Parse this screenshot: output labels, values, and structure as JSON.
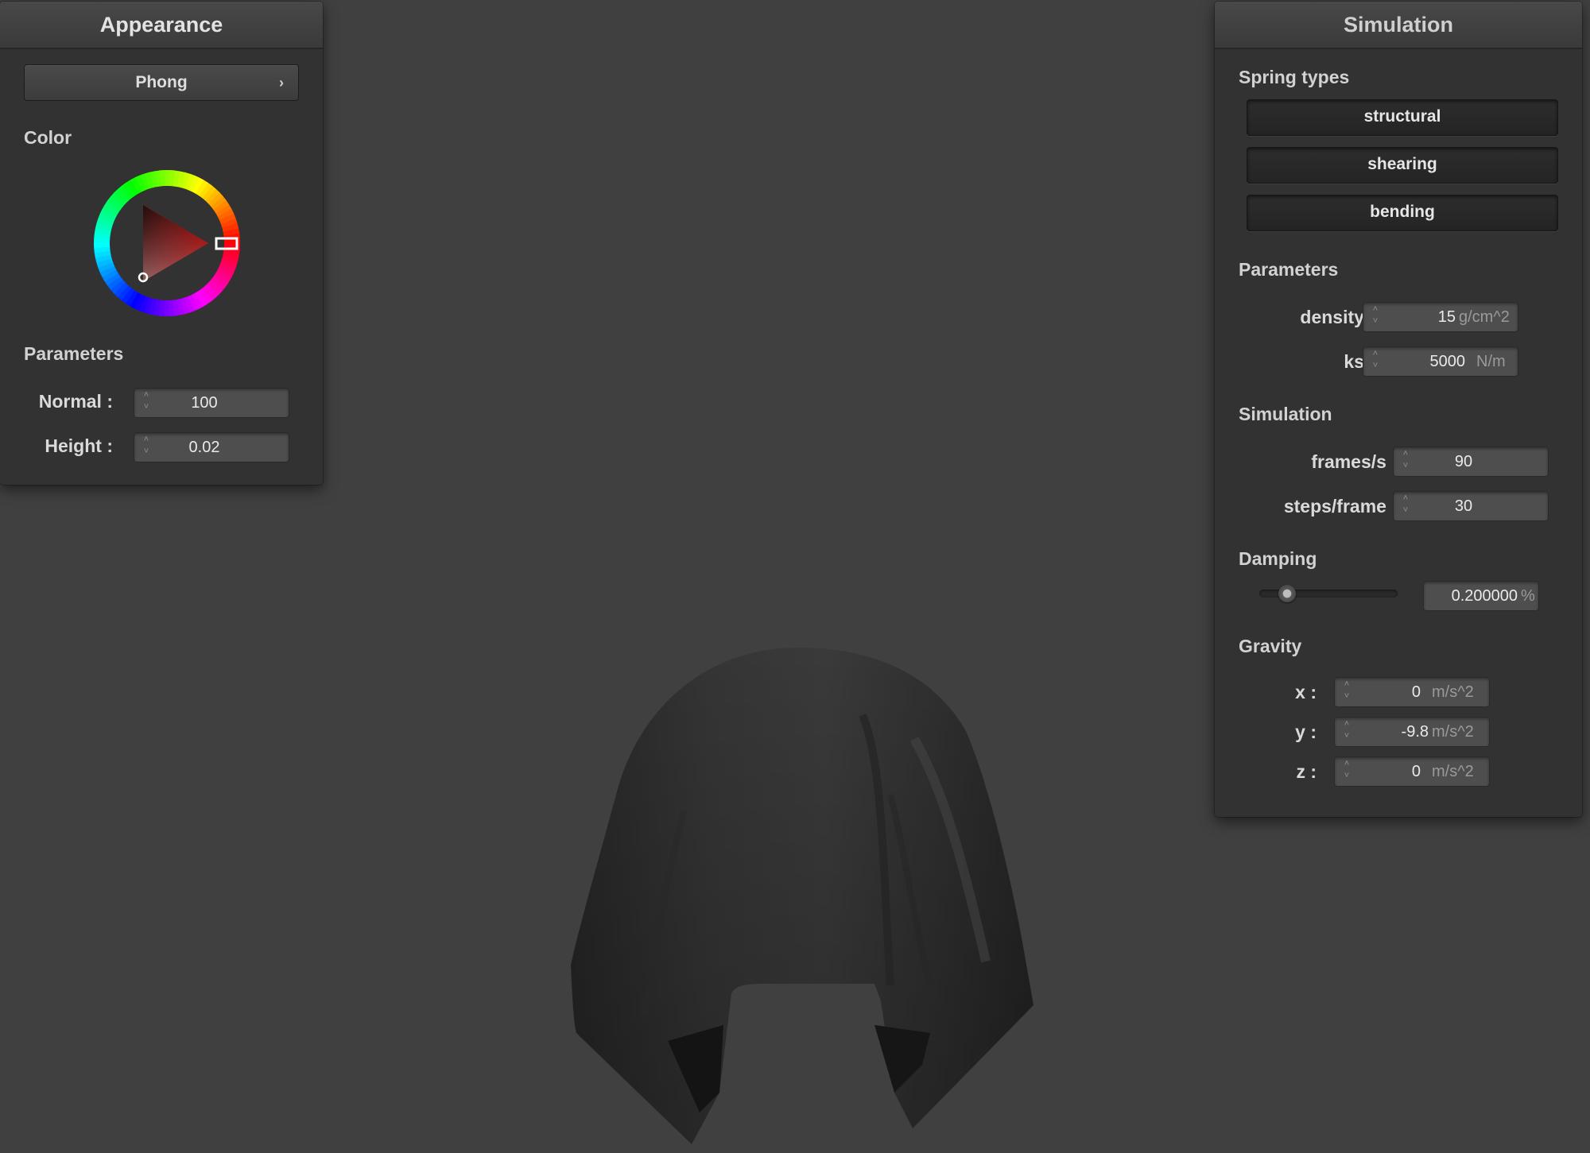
{
  "appearance": {
    "title": "Appearance",
    "shader": "Phong",
    "color_label": "Color",
    "selected_color": "#e01010",
    "parameters_label": "Parameters",
    "normal_label": "Normal :",
    "normal_value": "100",
    "height_label": "Height :",
    "height_value": "0.02"
  },
  "simulation": {
    "title": "Simulation",
    "spring_types_label": "Spring types",
    "springs": [
      "structural",
      "shearing",
      "bending"
    ],
    "parameters_label": "Parameters",
    "density_label": "density :",
    "density_value": "15",
    "density_unit": "g/cm^2",
    "ks_label": "ks :",
    "ks_value": "5000",
    "ks_unit": "N/m",
    "simulation_label": "Simulation",
    "fps_label": "frames/s :",
    "fps_value": "90",
    "steps_label": "steps/frame :",
    "steps_value": "30",
    "damping_label": "Damping",
    "damping_value": "0.200000",
    "damping_unit": "%",
    "damping_slider_fraction": 0.2,
    "gravity_label": "Gravity",
    "gx_label": "x :",
    "gx_value": "0",
    "gy_label": "y :",
    "gy_value": "-9.8",
    "gz_label": "z :",
    "gz_value": "0",
    "gravity_unit": "m/s^2"
  }
}
